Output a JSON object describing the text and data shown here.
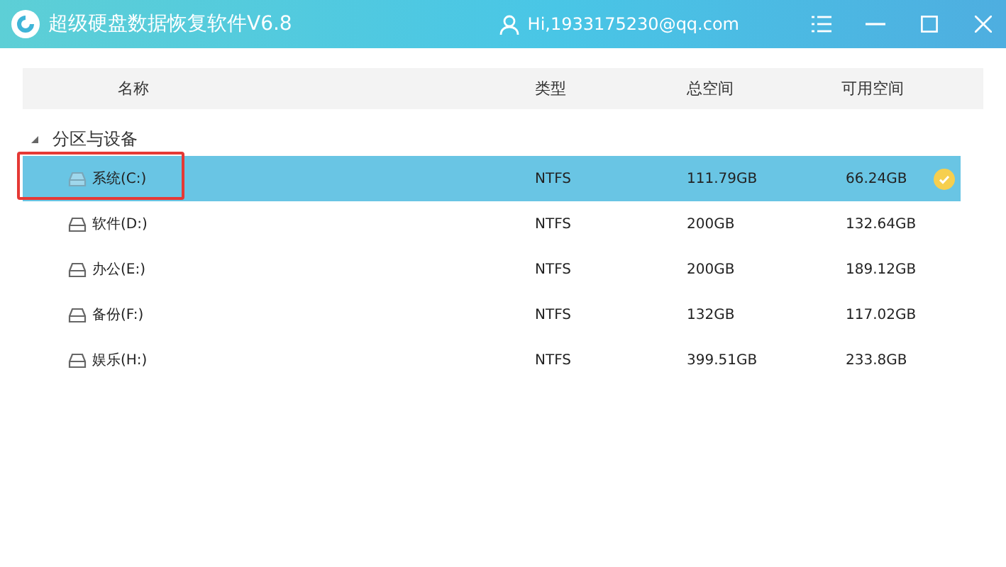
{
  "window": {
    "title": "超级硬盘数据恢复软件V6.8",
    "user": "Hi,1933175230@qq.com"
  },
  "table": {
    "columns": [
      "名称",
      "类型",
      "总空间",
      "可用空间"
    ],
    "group": {
      "label": "分区与设备",
      "expanded": true
    },
    "rows": [
      {
        "name": "系统(C:)",
        "type": "NTFS",
        "total": "111.79GB",
        "free": "66.24GB",
        "selected": true,
        "highlighted": true
      },
      {
        "name": "软件(D:)",
        "type": "NTFS",
        "total": "200GB",
        "free": "132.64GB",
        "selected": false,
        "highlighted": false
      },
      {
        "name": "办公(E:)",
        "type": "NTFS",
        "total": "200GB",
        "free": "189.12GB",
        "selected": false,
        "highlighted": false
      },
      {
        "name": "备份(F:)",
        "type": "NTFS",
        "total": "132GB",
        "free": "117.02GB",
        "selected": false,
        "highlighted": false
      },
      {
        "name": "娱乐(H:)",
        "type": "NTFS",
        "total": "399.51GB",
        "free": "233.8GB",
        "selected": false,
        "highlighted": false
      }
    ]
  }
}
